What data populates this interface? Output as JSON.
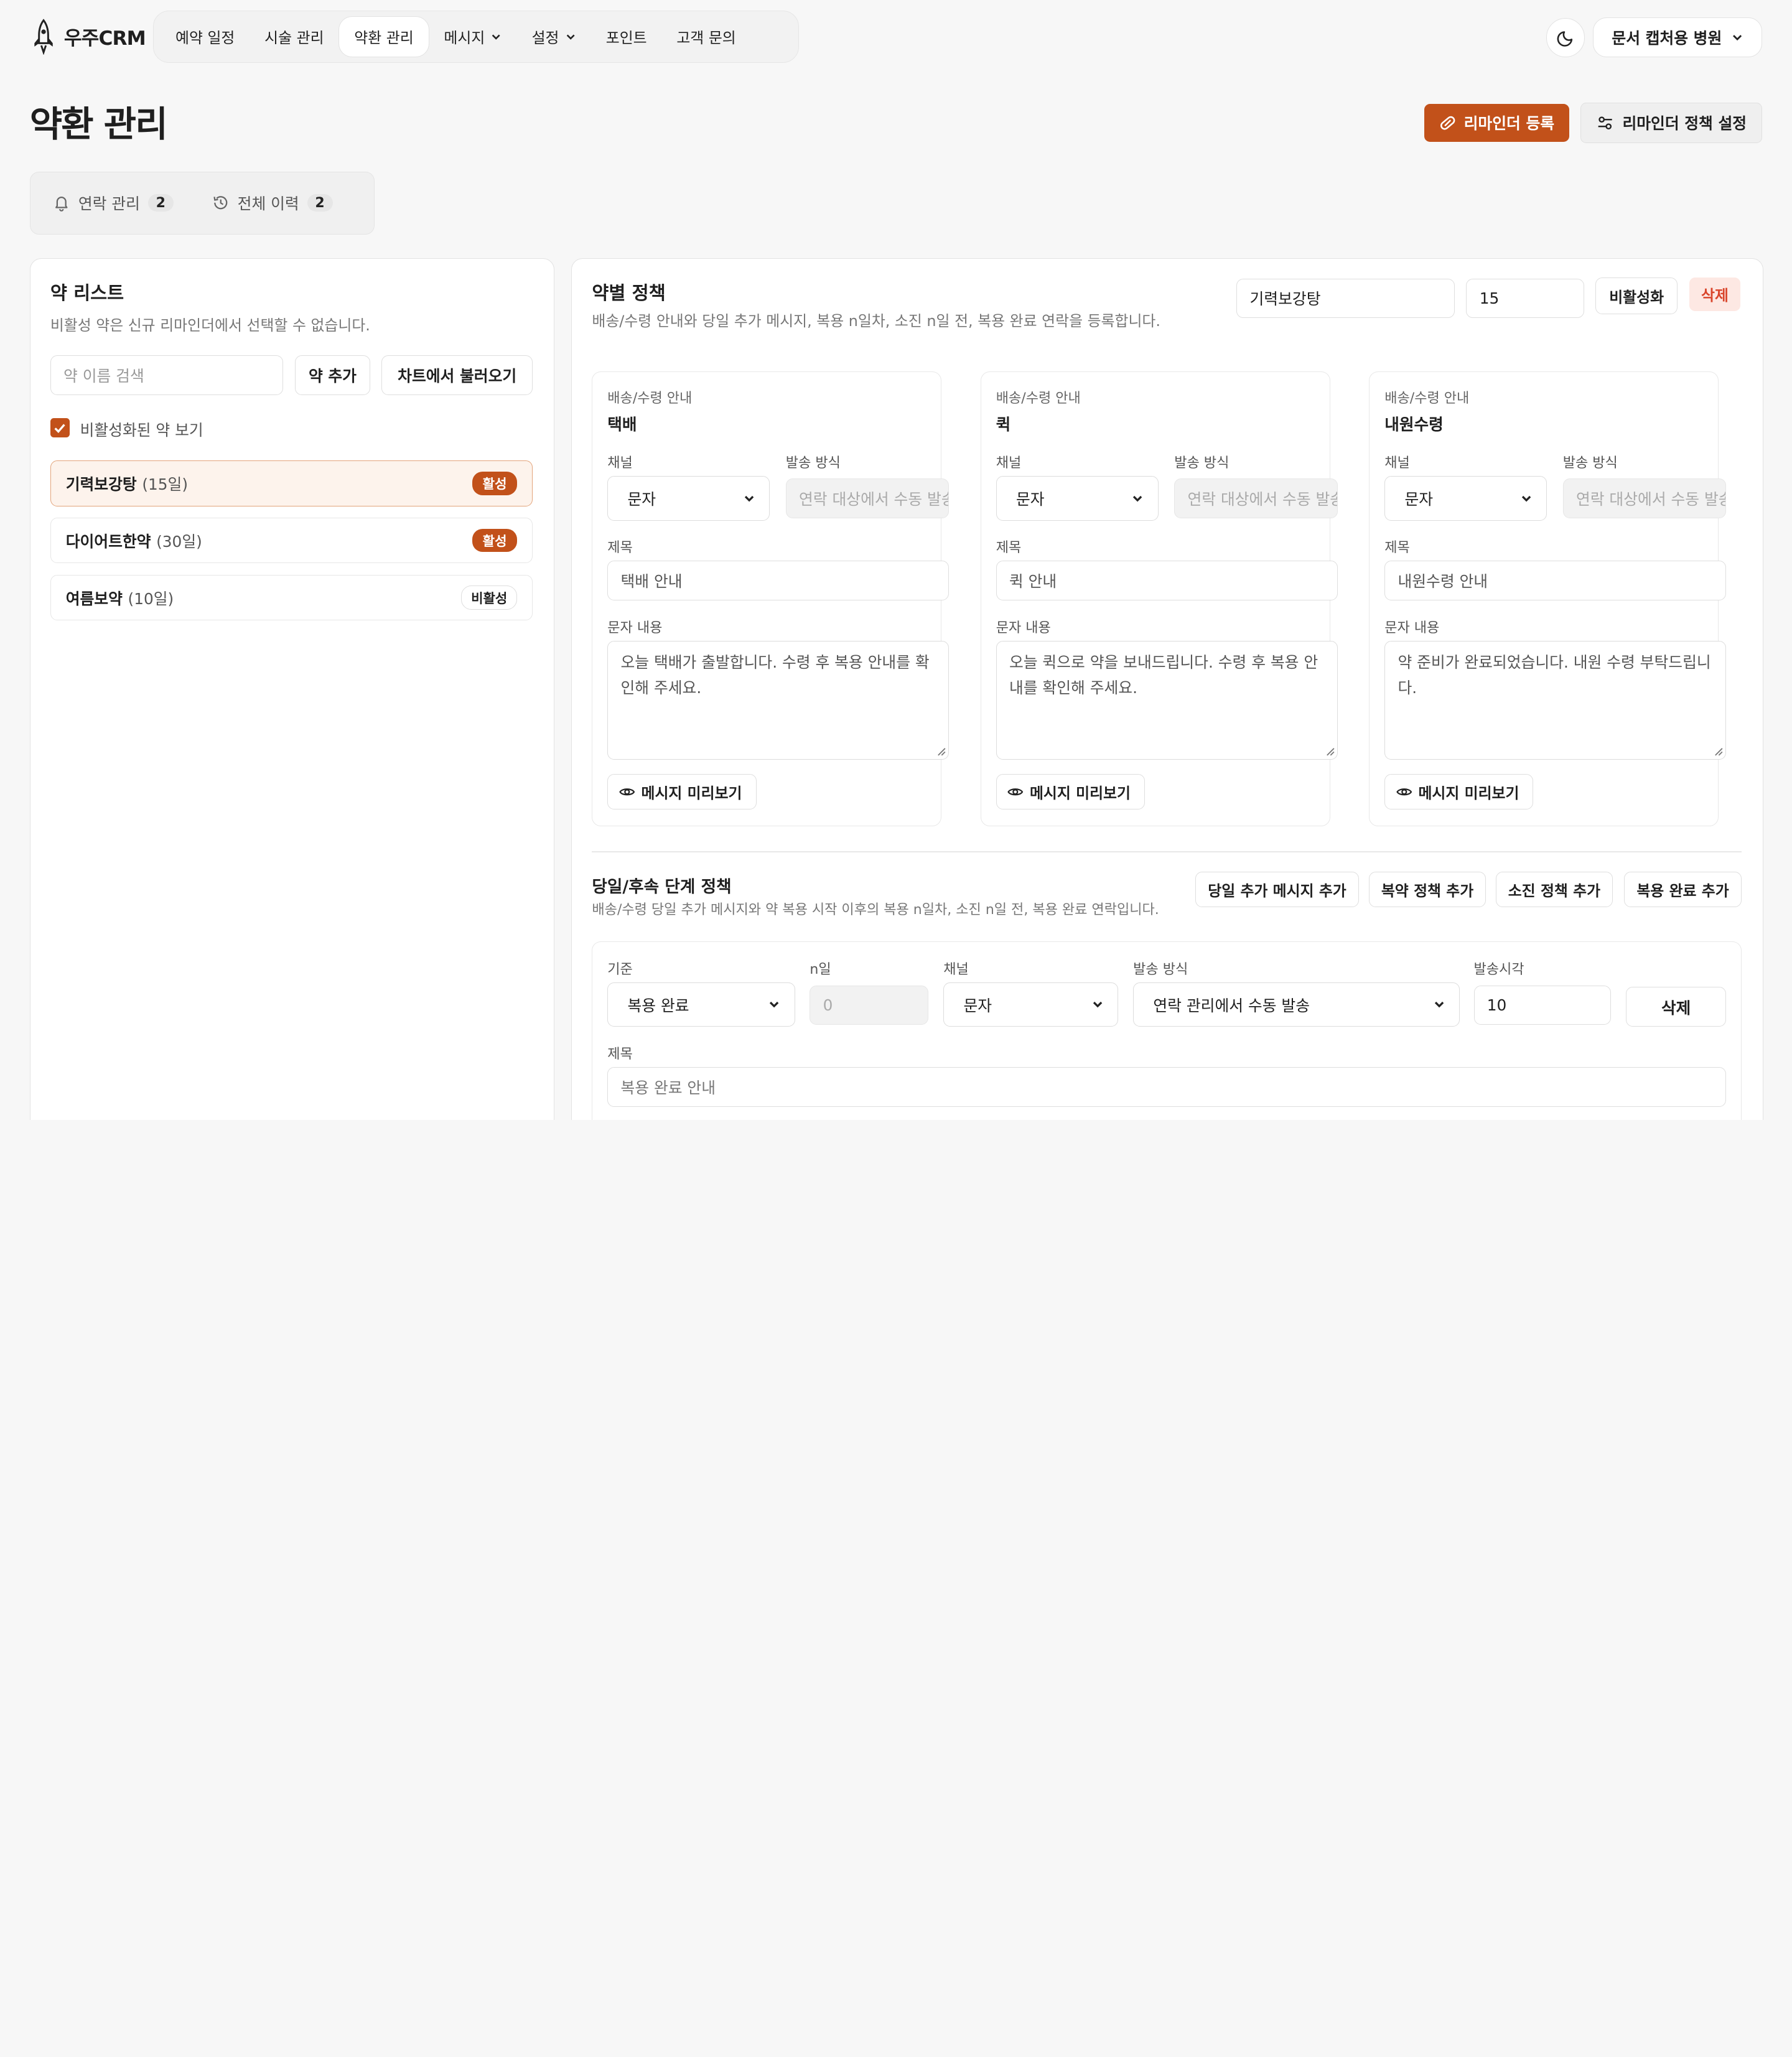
{
  "brand": {
    "name": "우주CRM"
  },
  "nav": {
    "items": [
      {
        "label": "예약 일정"
      },
      {
        "label": "시술 관리"
      },
      {
        "label": "약환 관리"
      },
      {
        "label": "메시지"
      },
      {
        "label": "설정"
      },
      {
        "label": "포인트"
      },
      {
        "label": "고객 문의"
      }
    ],
    "active_index": 2
  },
  "header": {
    "clinic_label": "문서 캡처용 병원"
  },
  "page": {
    "title": "약환 관리",
    "register_reminder_label": "리마인더 등록",
    "policy_settings_label": "리마인더 정책 설정"
  },
  "tabs": [
    {
      "label": "연락 관리",
      "count": "2"
    },
    {
      "label": "전체 이력",
      "count": "2"
    }
  ],
  "med_list": {
    "title": "약 리스트",
    "desc": "비활성 약은 신규 리마인더에서 선택할 수 없습니다.",
    "search_placeholder": "약 이름 검색",
    "add_label": "약 추가",
    "import_label": "차트에서 불러오기",
    "show_inactive_label": "비활성화된 약 보기",
    "show_inactive_checked": true,
    "items": [
      {
        "name": "기력보강탕",
        "days": "(15일)",
        "status": "활성",
        "active": true,
        "selected": true
      },
      {
        "name": "다이어트한약",
        "days": "(30일)",
        "status": "활성",
        "active": true,
        "selected": false
      },
      {
        "name": "여름보약",
        "days": "(10일)",
        "status": "비활성",
        "active": false,
        "selected": false
      }
    ]
  },
  "policy": {
    "title": "약별 정책",
    "desc": "배송/수령 안내와 당일 추가 메시지, 복용 n일차, 소진 n일 전, 복용 완료 연락을 등록합니다.",
    "med_name_value": "기력보강탕",
    "days_value": "15",
    "deactivate_label": "비활성화",
    "delete_label": "삭제",
    "cards": [
      {
        "eyebrow": "배송/수령 안내",
        "title": "택배",
        "channel_label": "채널",
        "channel_value": "문자",
        "method_label": "발송 방식",
        "method_placeholder": "연락 대상에서 수동 발송",
        "subject_label": "제목",
        "subject_value": "택배 안내",
        "body_label": "문자 내용",
        "body_value": "오늘 택배가 출발합니다. 수령 후 복용 안내를 확인해 주세요.",
        "preview_label": "메시지 미리보기"
      },
      {
        "eyebrow": "배송/수령 안내",
        "title": "퀵",
        "channel_label": "채널",
        "channel_value": "문자",
        "method_label": "발송 방식",
        "method_placeholder": "연락 대상에서 수동 발송",
        "subject_label": "제목",
        "subject_value": "퀵 안내",
        "body_label": "문자 내용",
        "body_value": "오늘 퀵으로 약을 보내드립니다. 수령 후 복용 안내를 확인해 주세요.",
        "preview_label": "메시지 미리보기"
      },
      {
        "eyebrow": "배송/수령 안내",
        "title": "내원수령",
        "channel_label": "채널",
        "channel_value": "문자",
        "method_label": "발송 방식",
        "method_placeholder": "연락 대상에서 수동 발송",
        "subject_label": "제목",
        "subject_value": "내원수령 안내",
        "body_label": "문자 내용",
        "body_value": "약 준비가 완료되었습니다. 내원 수령 부탁드립니다.",
        "preview_label": "메시지 미리보기"
      }
    ]
  },
  "stage": {
    "title": "당일/후속 단계 정책",
    "desc": "배송/수령 당일 추가 메시지와 약 복용 시작 이후의 복용 n일차, 소진 n일 전, 복용 완료 연락입니다.",
    "buttons": [
      "당일 추가 메시지 추가",
      "복약 정책 추가",
      "소진 정책 추가",
      "복용 완료 추가"
    ],
    "row": {
      "basis_label": "기준",
      "basis_value": "복용 완료",
      "nday_label": "n일",
      "nday_placeholder": "0",
      "channel_label": "채널",
      "channel_value": "문자",
      "method_label": "발송 방식",
      "method_value": "연락 관리에서 수동 발송",
      "time_label": "발송시각",
      "time_value": "10",
      "delete_label": "삭제",
      "subject_label": "제목",
      "subject_placeholder": "복용 완료 안내"
    }
  },
  "colors": {
    "accent": "#c2511a",
    "danger": "#d9452b",
    "danger_bg": "#fde8e3"
  }
}
